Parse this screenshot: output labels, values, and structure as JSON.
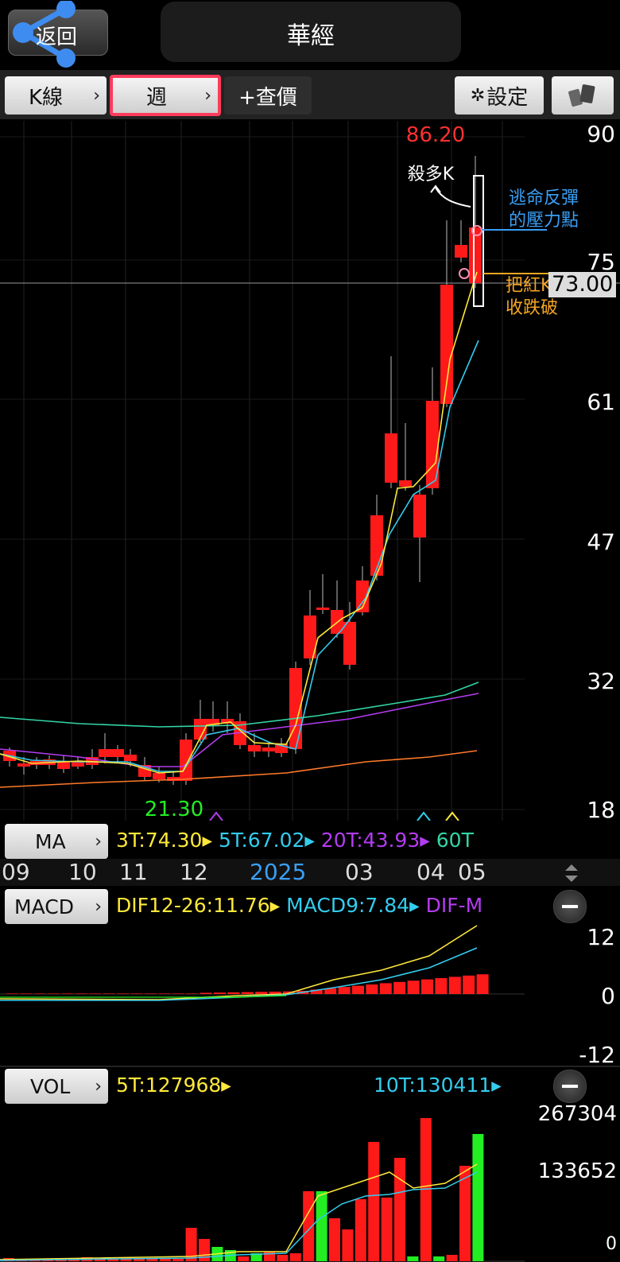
{
  "header": {
    "back_label": "返回",
    "title": "華經"
  },
  "toolbar": {
    "kline_label": "K線",
    "period_label": "週",
    "add_quote_label": "+查價",
    "settings_label": "設定"
  },
  "price_axis": {
    "ticks": [
      "90",
      "75",
      "61",
      "47",
      "32",
      "18"
    ],
    "current_price": "73.00"
  },
  "chart_marks": {
    "high": "86.20",
    "low": "21.30"
  },
  "annotations": {
    "kill_long": "殺多K",
    "rebound_line1": "逃命反彈",
    "rebound_line2": "的壓力點",
    "break_line1": "把紅K",
    "break_line2": "收跌破"
  },
  "ma_row": {
    "label": "MA",
    "ma3": "3T:74.30",
    "ma5": "5T:67.02",
    "ma20": "20T:43.93",
    "ma60": "60T"
  },
  "months": [
    "09",
    "10",
    "11",
    "12",
    "2025",
    "03",
    "04",
    "05"
  ],
  "macd_row": {
    "label": "MACD",
    "dif": "DIF12-26:11.76",
    "macd": "MACD9:7.84",
    "difm": "DIF-M"
  },
  "macd_axis": {
    "ticks": [
      "12",
      "0",
      "-12"
    ]
  },
  "vol_row": {
    "label": "VOL",
    "ma5": "5T:127968",
    "ma10": "10T:130411"
  },
  "vol_axis": {
    "ticks": [
      "267304",
      "133652",
      "0"
    ]
  },
  "colors": {
    "up": "#ff1a1a",
    "down": "#22ee22",
    "ma3": "#ffe83a",
    "ma5": "#33ccee",
    "ma20": "#b43cf0",
    "ma60": "#33d6a6",
    "long_ma": "#ff7a2a",
    "highlight_border": "#ff3b5c",
    "rebound_text": "#3a9ff5",
    "break_text": "#f5a623"
  }
}
